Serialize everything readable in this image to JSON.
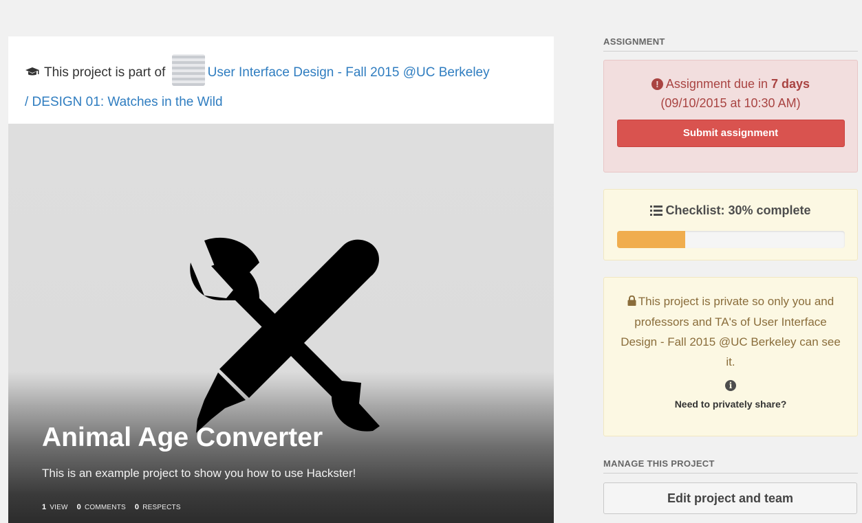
{
  "project_context": {
    "prefix": "This project is part of",
    "course_link": "User Interface Design - Fall 2015 @UC Berkeley",
    "assignment_link": "/ DESIGN 01: Watches in the Wild"
  },
  "cover": {
    "title": "Animal Age Converter",
    "description": "This is an example project to show you how to use Hackster!",
    "stats": [
      {
        "count": "1",
        "label": "view"
      },
      {
        "count": "0",
        "label": "comments"
      },
      {
        "count": "0",
        "label": "respects"
      }
    ]
  },
  "assignment": {
    "heading": "ASSIGNMENT",
    "due_prefix": "Assignment due in",
    "due_days": "7 days",
    "due_date": "(09/10/2015 at 10:30 AM)",
    "submit_label": "Submit assignment"
  },
  "checklist": {
    "label": "Checklist: 30% complete",
    "progress": 0.3
  },
  "privacy": {
    "message": "This project is private so only you and professors and TA's of User Interface Design - Fall 2015 @UC Berkeley can see it.",
    "share_link": "Need to privately share?"
  },
  "manage": {
    "heading": "MANAGE THIS PROJECT",
    "edit_label": "Edit project and team"
  },
  "colors": {
    "link": "#2f7dc0",
    "danger": "#d9534f",
    "warning_fill": "#f0ad4e"
  }
}
